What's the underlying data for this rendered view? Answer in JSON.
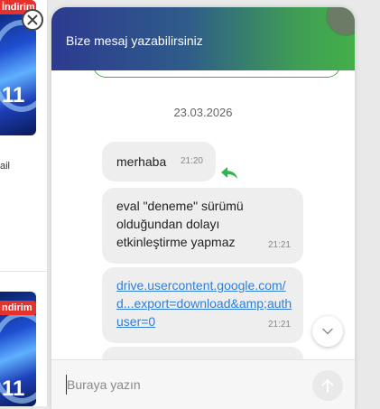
{
  "background": {
    "promo_top": {
      "badge": "İndirim",
      "number": "11"
    },
    "side_text": "ail",
    "promo_bottom": {
      "badge": "ndirim",
      "number": "11"
    }
  },
  "chat": {
    "title": "Bize mesaj yazabilirsiniz",
    "date_separator": "23.03.2026",
    "messages": [
      {
        "text": "merhaba",
        "time": "21:20"
      },
      {
        "text": "eval \"deneme\" sürümü olduğundan dolayı etkinleştirme yapmaz",
        "time": "21:21"
      },
      {
        "text": "drive.usercontent.google.com/d...export=download&amp;authuser=0",
        "time": "21:21"
      }
    ],
    "composer": {
      "placeholder": "Buraya yazın"
    },
    "colors": {
      "header_start": "#2d3a90",
      "header_end": "#43b04a",
      "link": "#2f7fd8",
      "reply_arrow": "#2fb84a"
    }
  },
  "icons": {
    "close": "close-icon",
    "reply": "reply-arrow-icon",
    "scroll_down": "chevron-down-icon",
    "send": "send-arrow-up-icon"
  }
}
